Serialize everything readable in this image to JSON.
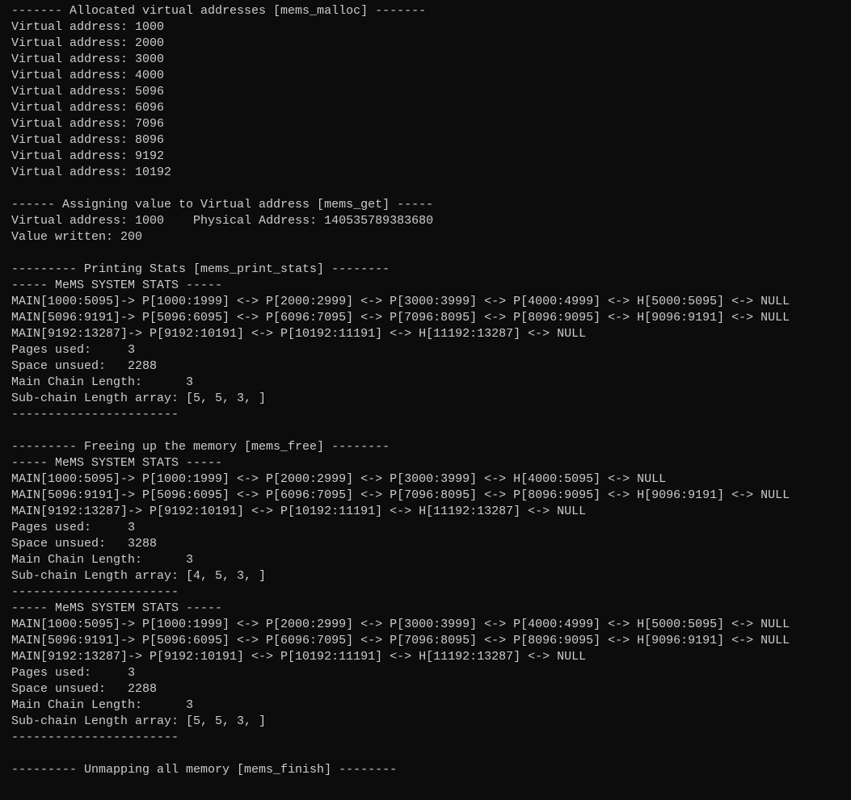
{
  "section_alloc_header": "------- Allocated virtual addresses [mems_malloc] -------",
  "alloc_lines": [
    "Virtual address: 1000",
    "Virtual address: 2000",
    "Virtual address: 3000",
    "Virtual address: 4000",
    "Virtual address: 5096",
    "Virtual address: 6096",
    "Virtual address: 7096",
    "Virtual address: 8096",
    "Virtual address: 9192",
    "Virtual address: 10192"
  ],
  "section_assign_header": "------ Assigning value to Virtual address [mems_get] -----",
  "assign_line": "Virtual address: 1000\t Physical Address: 140535789383680",
  "value_written_line": "Value written: 200",
  "section_stats_header": "--------- Printing Stats [mems_print_stats] --------",
  "stats1": {
    "title": "----- MeMS SYSTEM STATS -----",
    "chain_lines": [
      "MAIN[1000:5095]-> P[1000:1999] <-> P[2000:2999] <-> P[3000:3999] <-> P[4000:4999] <-> H[5000:5095] <-> NULL",
      "MAIN[5096:9191]-> P[5096:6095] <-> P[6096:7095] <-> P[7096:8095] <-> P[8096:9095] <-> H[9096:9191] <-> NULL",
      "MAIN[9192:13287]-> P[9192:10191] <-> P[10192:11191] <-> H[11192:13287] <-> NULL"
    ],
    "pages_used": "Pages used:\t3",
    "space_unused": "Space unsued:\t2288",
    "main_chain_len": "Main Chain Length:\t3",
    "sub_chain": "Sub-chain Length array: [5, 5, 3, ]",
    "divider": "-----------------------"
  },
  "section_free_header": "--------- Freeing up the memory [mems_free] --------",
  "stats2": {
    "title": "----- MeMS SYSTEM STATS -----",
    "chain_lines": [
      "MAIN[1000:5095]-> P[1000:1999] <-> P[2000:2999] <-> P[3000:3999] <-> H[4000:5095] <-> NULL",
      "MAIN[5096:9191]-> P[5096:6095] <-> P[6096:7095] <-> P[7096:8095] <-> P[8096:9095] <-> H[9096:9191] <-> NULL",
      "MAIN[9192:13287]-> P[9192:10191] <-> P[10192:11191] <-> H[11192:13287] <-> NULL"
    ],
    "pages_used": "Pages used:\t3",
    "space_unused": "Space unsued:\t3288",
    "main_chain_len": "Main Chain Length:\t3",
    "sub_chain": "Sub-chain Length array: [4, 5, 3, ]",
    "divider": "-----------------------"
  },
  "stats3": {
    "title": "----- MeMS SYSTEM STATS -----",
    "chain_lines": [
      "MAIN[1000:5095]-> P[1000:1999] <-> P[2000:2999] <-> P[3000:3999] <-> P[4000:4999] <-> H[5000:5095] <-> NULL",
      "MAIN[5096:9191]-> P[5096:6095] <-> P[6096:7095] <-> P[7096:8095] <-> P[8096:9095] <-> H[9096:9191] <-> NULL",
      "MAIN[9192:13287]-> P[9192:10191] <-> P[10192:11191] <-> H[11192:13287] <-> NULL"
    ],
    "pages_used": "Pages used:\t3",
    "space_unused": "Space unsued:\t2288",
    "main_chain_len": "Main Chain Length:\t3",
    "sub_chain": "Sub-chain Length array: [5, 5, 3, ]",
    "divider": "-----------------------"
  },
  "section_unmap_header": "--------- Unmapping all memory [mems_finish] --------"
}
